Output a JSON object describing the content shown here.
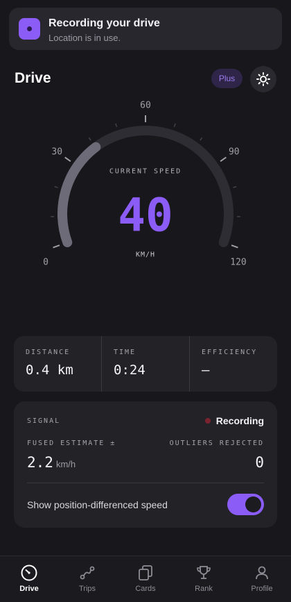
{
  "notification": {
    "title": "Recording your drive",
    "subtitle": "Location is in use.",
    "icon": "record-icon"
  },
  "header": {
    "title": "Drive",
    "badge": "Plus",
    "theme_icon": "sun-icon"
  },
  "gauge": {
    "caption": "CURRENT SPEED",
    "value": "40",
    "unit": "KM/H",
    "speed": 40,
    "max": 120,
    "ticks": [
      "0",
      "30",
      "60",
      "90",
      "120"
    ],
    "colors": {
      "track": "#2e2d33",
      "fill": "#6e6b78",
      "accent": "#8b5cf6"
    }
  },
  "stats": [
    {
      "label": "DISTANCE",
      "value": "0.4 km"
    },
    {
      "label": "TIME",
      "value": "0:24"
    },
    {
      "label": "EFFICIENCY",
      "value": "—"
    }
  ],
  "signal": {
    "label": "SIGNAL",
    "status": "Recording",
    "fused_label": "FUSED ESTIMATE ±",
    "fused_value": "2.2",
    "fused_unit": "km/h",
    "outliers_label": "OUTLIERS REJECTED",
    "outliers_value": "0",
    "toggle_label": "Show position-differenced speed",
    "toggle_on": true
  },
  "nav": {
    "items": [
      {
        "label": "Drive",
        "icon": "speedometer-icon",
        "active": true
      },
      {
        "label": "Trips",
        "icon": "route-icon",
        "active": false
      },
      {
        "label": "Cards",
        "icon": "cards-icon",
        "active": false
      },
      {
        "label": "Rank",
        "icon": "trophy-icon",
        "active": false
      },
      {
        "label": "Profile",
        "icon": "person-icon",
        "active": false
      }
    ]
  }
}
